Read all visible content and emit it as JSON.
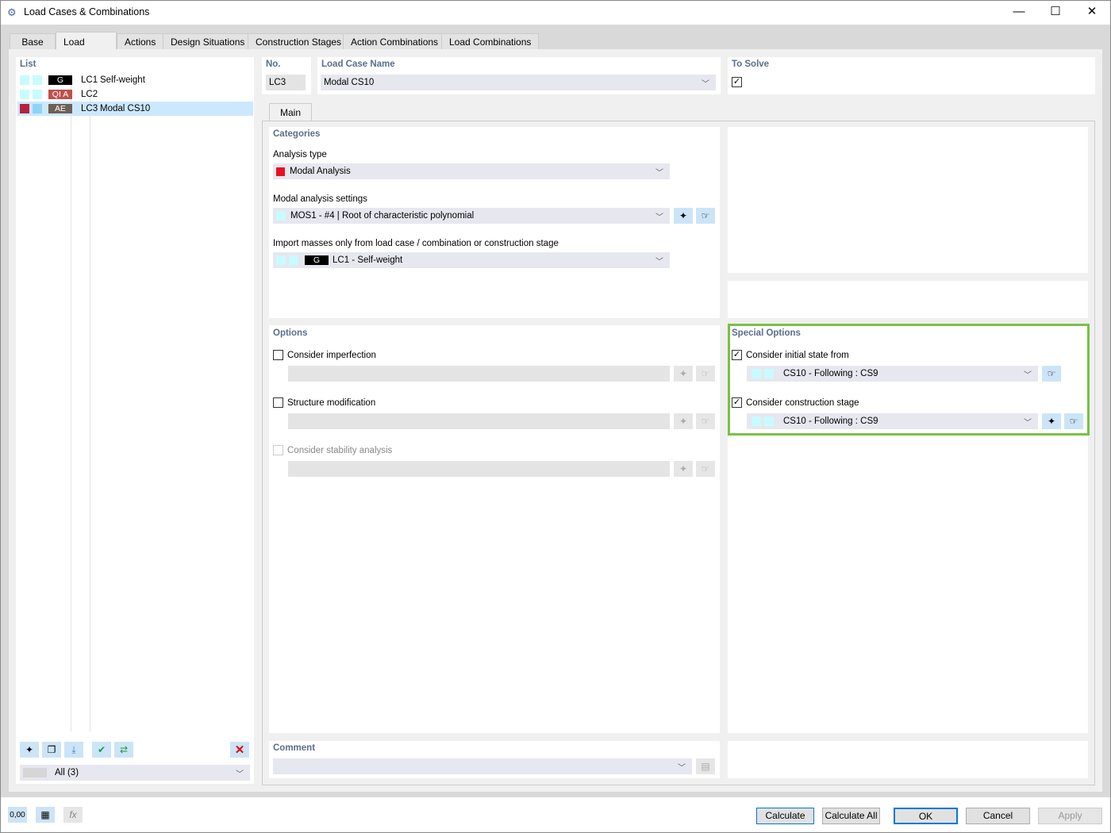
{
  "window": {
    "title": "Load Cases & Combinations"
  },
  "tabs": [
    "Base",
    "Load Cases",
    "Actions",
    "Design Situations",
    "Construction Stages",
    "Action Combinations",
    "Load Combinations"
  ],
  "active_tab": "Load Cases",
  "list": {
    "header": "List",
    "items": [
      {
        "tag": "G",
        "tag_color": "#000000",
        "id": "LC1",
        "name": "Self-weight"
      },
      {
        "tag": "QI A",
        "tag_color": "#c0504d",
        "id": "LC2",
        "name": ""
      },
      {
        "tag": "AE",
        "tag_color": "#6e6055",
        "id": "LC3",
        "name": "Modal CS10",
        "selected": true
      }
    ],
    "filter": "All (3)"
  },
  "no": {
    "label": "No.",
    "value": "LC3"
  },
  "name": {
    "label": "Load Case Name",
    "value": "Modal CS10"
  },
  "to_solve": {
    "label": "To Solve",
    "checked": true
  },
  "subtab": "Main",
  "categories": {
    "header": "Categories",
    "analysis_type_label": "Analysis type",
    "analysis_type": "Modal Analysis",
    "analysis_color": "#e81123",
    "modal_settings_label": "Modal analysis settings",
    "modal_settings": "MOS1 - #4 | Root of characteristic polynomial",
    "import_label": "Import masses only from load case / combination or construction stage",
    "import_tag": "G",
    "import_value": "LC1 - Self-weight"
  },
  "options": {
    "header": "Options",
    "items": [
      {
        "label": "Consider imperfection",
        "checked": false,
        "enabled": true
      },
      {
        "label": "Structure modification",
        "checked": false,
        "enabled": true
      },
      {
        "label": "Consider stability analysis",
        "checked": false,
        "enabled": false
      }
    ]
  },
  "special": {
    "header": "Special Options",
    "highlight": "#7ac143",
    "items": [
      {
        "label": "Consider initial state from",
        "checked": true,
        "value": "CS10 - Following : CS9"
      },
      {
        "label": "Consider construction stage",
        "checked": true,
        "value": "CS10 - Following : CS9"
      }
    ]
  },
  "comment": {
    "header": "Comment",
    "value": ""
  },
  "buttons": {
    "calculate": "Calculate",
    "calculate_all": "Calculate All",
    "ok": "OK",
    "cancel": "Cancel",
    "apply": "Apply"
  },
  "footer_icons": {
    "units": "0,00"
  }
}
